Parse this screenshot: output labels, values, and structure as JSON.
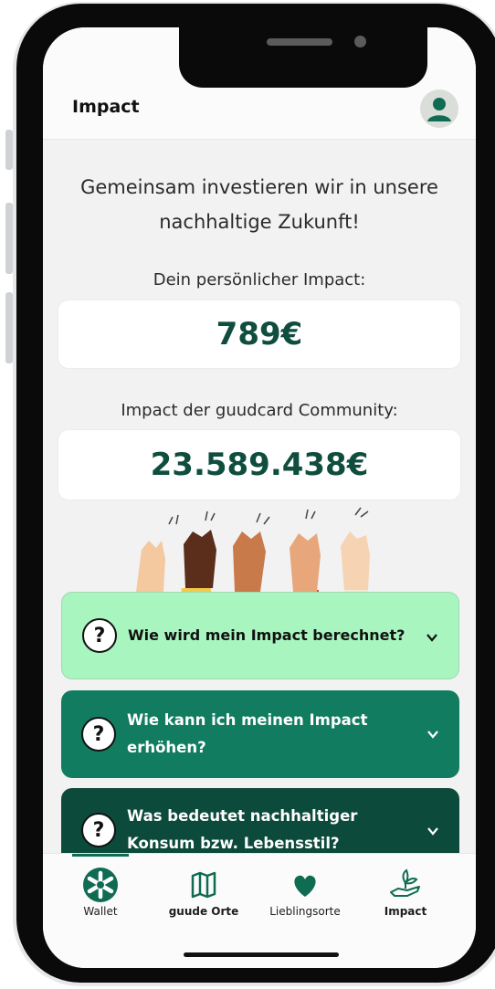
{
  "header": {
    "title": "Impact",
    "profile_icon": "user-icon"
  },
  "intro": {
    "line1": "Gemeinsam investieren wir in unsere",
    "line2": "nachhaltige Zukunft!"
  },
  "personal": {
    "label": "Dein persönlicher Impact:",
    "value": "789€"
  },
  "community": {
    "label": "Impact der guudcard Community:",
    "value": "23.589.438€"
  },
  "illustration": {
    "name": "raised-hands-illustration"
  },
  "faq": [
    {
      "question": "Wie wird mein Impact berechnet?",
      "bg": "#a8f5c0",
      "text_color": "#111111"
    },
    {
      "question_line1": "Wie kann ich meinen Impact",
      "question_line2": "erhöhen?",
      "bg": "#117c60",
      "text_color": "#ffffff"
    },
    {
      "question_line1": "Was bedeutet nachhaltiger",
      "question_line2": "Konsum bzw. Lebensstil?",
      "bg": "#0c4a3b",
      "text_color": "#ffffff"
    }
  ],
  "nav": [
    {
      "label": "Wallet",
      "icon": "asterisk-logo-icon"
    },
    {
      "label": "guude Orte",
      "icon": "map-icon"
    },
    {
      "label": "Lieblingsorte",
      "icon": "heart-icon"
    },
    {
      "label": "Impact",
      "icon": "hand-plant-icon"
    }
  ],
  "colors": {
    "brand_dark": "#0f4d3f",
    "brand_green": "#117c60",
    "mint": "#a8f5c0"
  }
}
